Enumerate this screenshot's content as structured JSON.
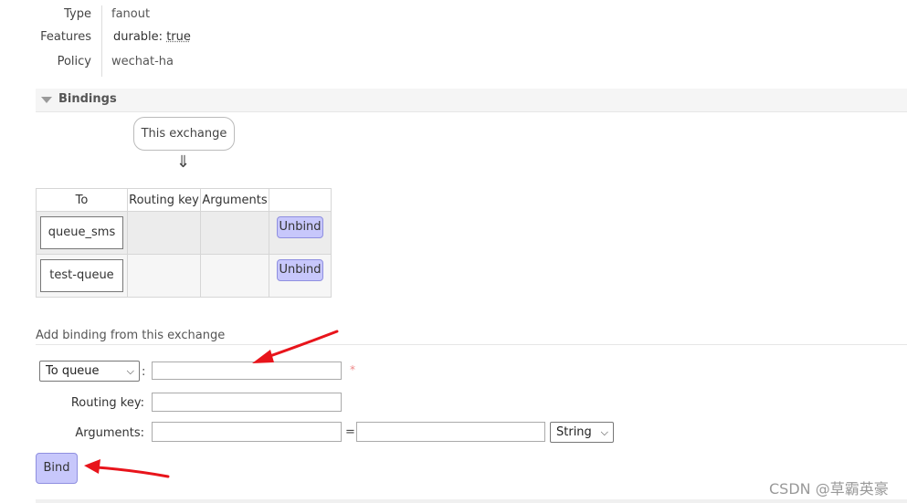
{
  "details": {
    "type_label": "Type",
    "type_value": "fanout",
    "features_label": "Features",
    "features_key": "durable:",
    "features_value": "true",
    "policy_label": "Policy",
    "policy_value": "wechat-ha"
  },
  "bindings": {
    "title": "Bindings",
    "source_label": "This exchange",
    "arrow": "⇓",
    "columns": [
      "To",
      "Routing key",
      "Arguments",
      ""
    ],
    "rows": [
      {
        "to": "queue_sms",
        "routing_key": "",
        "arguments": "",
        "action": "Unbind"
      },
      {
        "to": "test-queue",
        "routing_key": "",
        "arguments": "",
        "action": "Unbind"
      }
    ]
  },
  "add_binding": {
    "title": "Add binding from this exchange",
    "destination_type": "To queue",
    "destination_value": "",
    "required_mark": "*",
    "routing_key_label": "Routing key:",
    "routing_key_value": "",
    "arguments_label": "Arguments:",
    "argument_key": "",
    "equals": "=",
    "argument_value": "",
    "argument_type": "String",
    "bind_button": "Bind"
  },
  "annotation_color": "#e8141b",
  "watermark": "CSDN @草霸英豪"
}
